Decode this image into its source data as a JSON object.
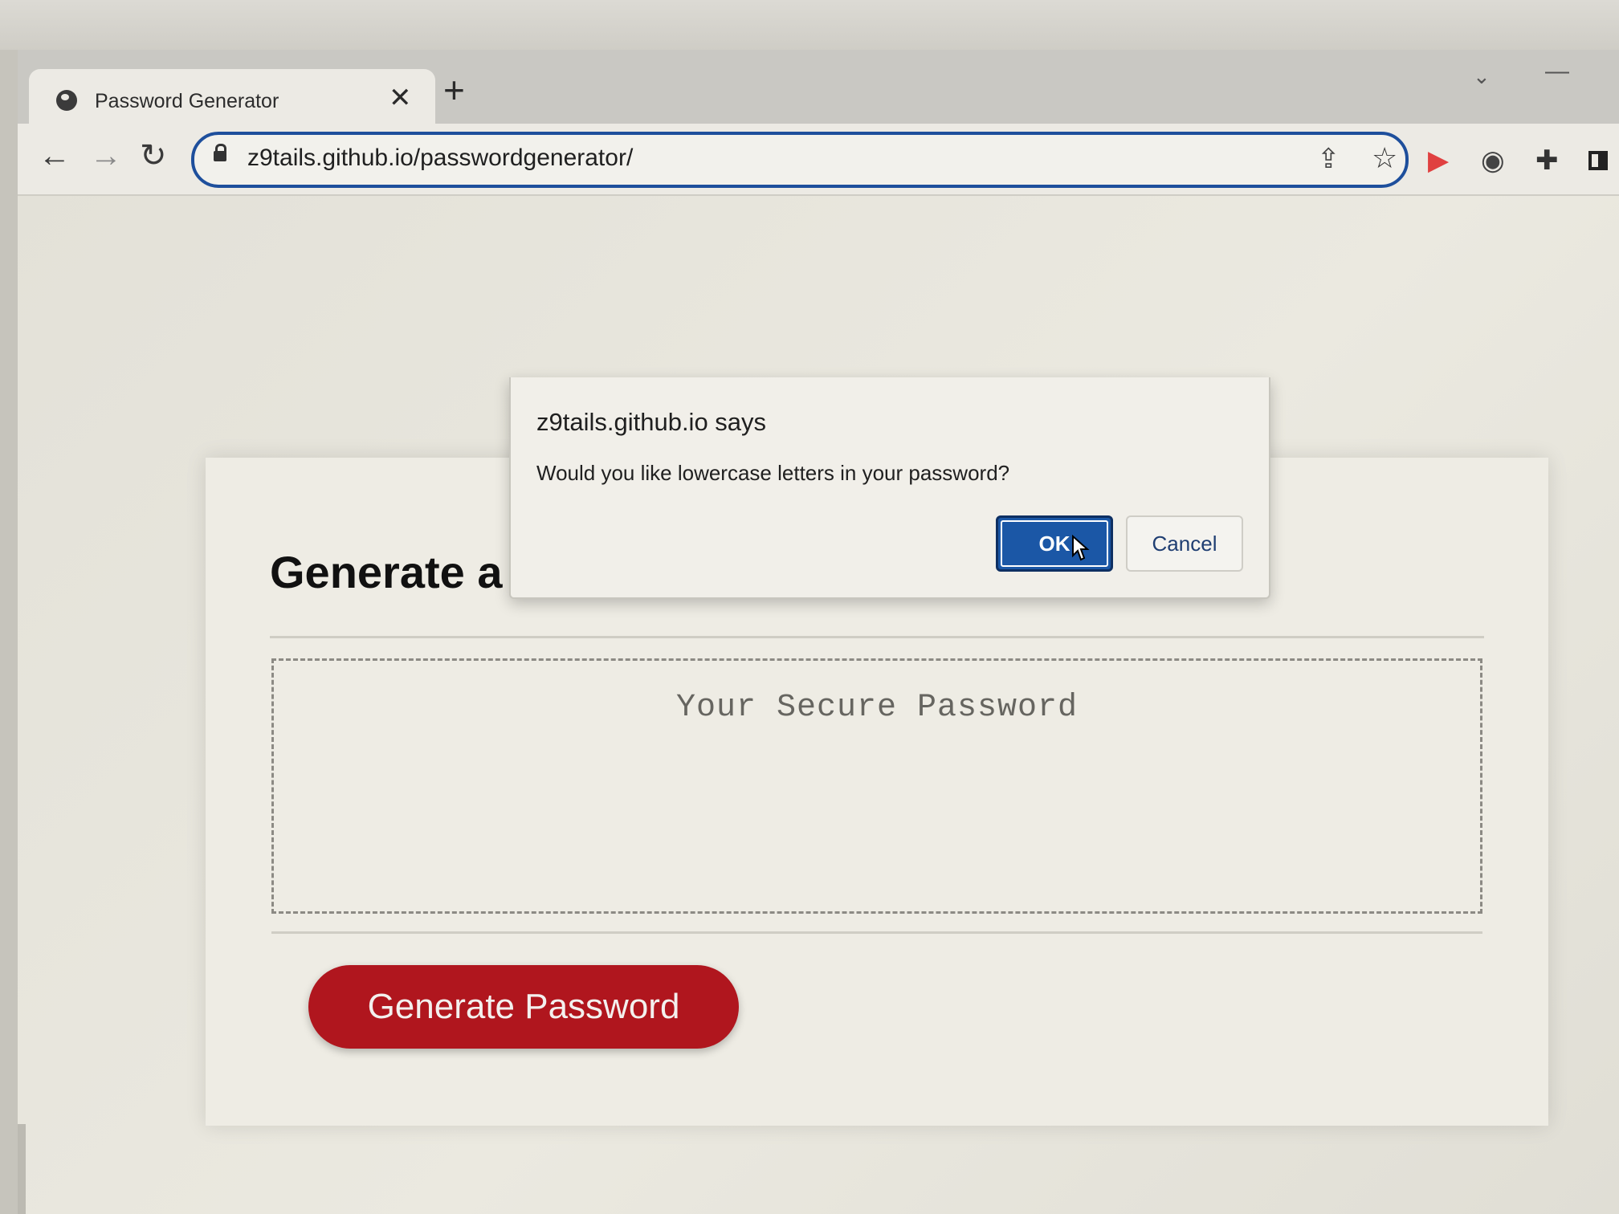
{
  "browser": {
    "tab": {
      "title": "Password Generator",
      "close_glyph": "✕",
      "favicon": "globe-icon"
    },
    "new_tab_glyph": "+",
    "tabs_menu_glyph": "⌄",
    "minimize_glyph": "—",
    "nav": {
      "back": "←",
      "forward": "→",
      "reload": "↻"
    },
    "address_bar": {
      "url": "z9tails.github.io/passwordgenerator/"
    },
    "icons": {
      "share": "⇪",
      "star": "☆",
      "ext_red": "▶",
      "ext_camera": "◉",
      "ext_puzzle": "✚"
    }
  },
  "dialog": {
    "origin": "z9tails.github.io says",
    "message": "Would you like lowercase letters in your password?",
    "ok_label": "OK",
    "cancel_label": "Cancel"
  },
  "page": {
    "title": "Generate a Password",
    "password_placeholder": "Your Secure Password",
    "generate_button": "Generate Password"
  },
  "colors": {
    "accent_blue": "#1b57a6",
    "generate_red": "#b0161e"
  }
}
